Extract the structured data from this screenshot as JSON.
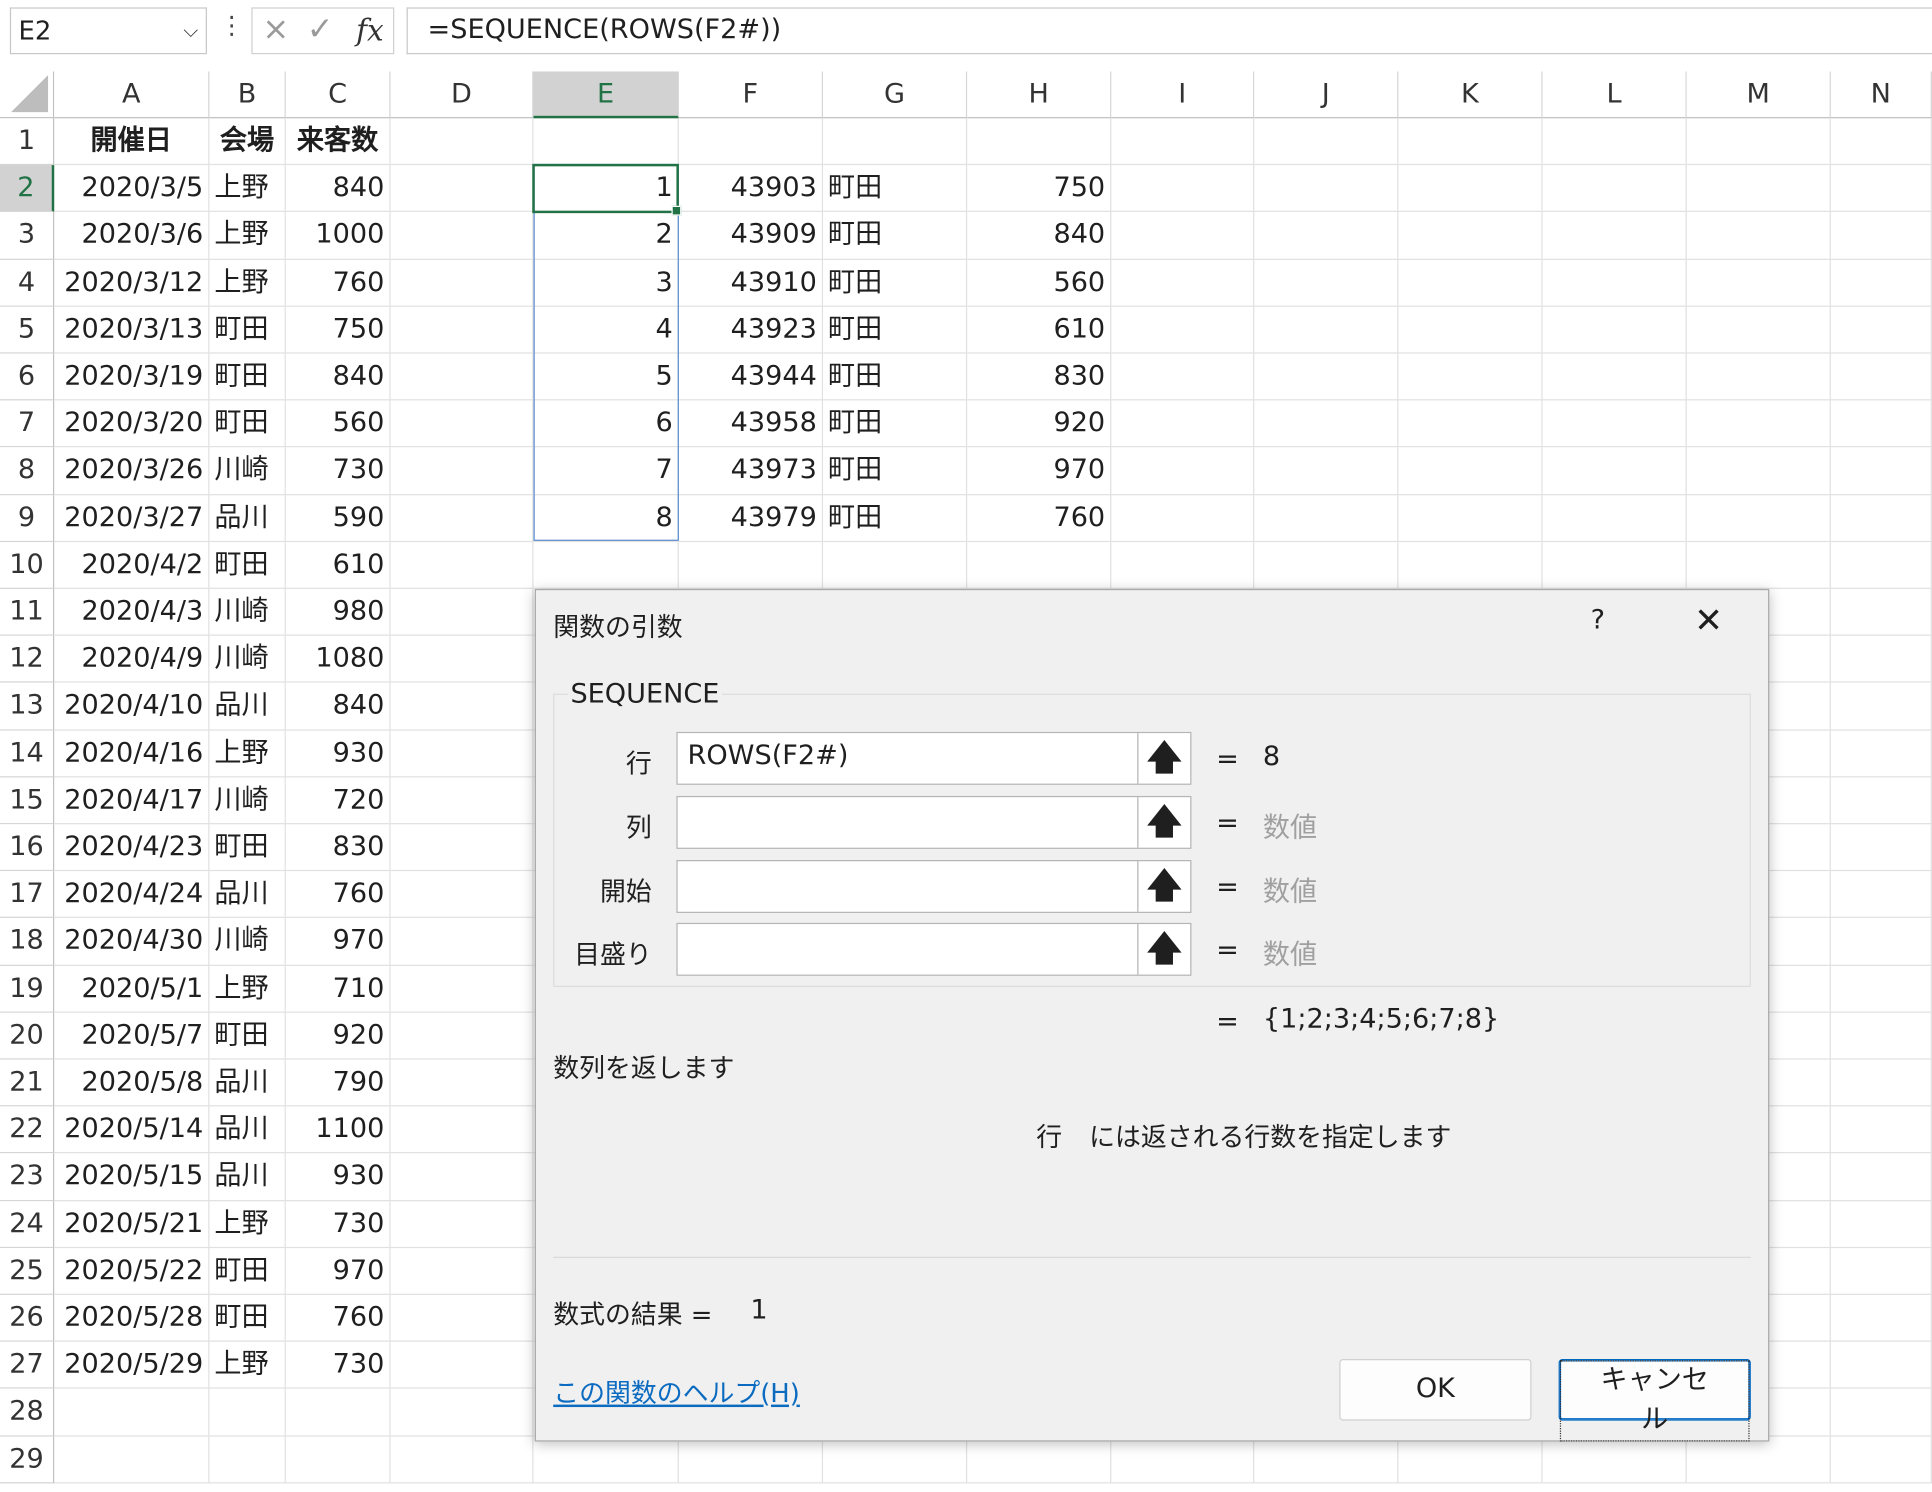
{
  "formula_bar": {
    "name_box": "E2",
    "formula": "=SEQUENCE(ROWS(F2#))",
    "cancel_icon": "×",
    "enter_icon": "✓",
    "fx_icon": "fx"
  },
  "columns": [
    "A",
    "B",
    "C",
    "D",
    "E",
    "F",
    "G",
    "H",
    "I",
    "J",
    "K",
    "L",
    "M",
    "N"
  ],
  "rows": [
    "1",
    "2",
    "3",
    "4",
    "5",
    "6",
    "7",
    "8",
    "9",
    "10",
    "11",
    "12",
    "13",
    "14",
    "15",
    "16",
    "17",
    "18",
    "19",
    "20",
    "21",
    "22",
    "23",
    "24",
    "25",
    "26",
    "27",
    "28",
    "29"
  ],
  "headers": {
    "date": "開催日",
    "venue": "会場",
    "visitors": "来客数"
  },
  "table": [
    [
      "2020/3/5",
      "上野",
      "840"
    ],
    [
      "2020/3/6",
      "上野",
      "1000"
    ],
    [
      "2020/3/12",
      "上野",
      "760"
    ],
    [
      "2020/3/13",
      "町田",
      "750"
    ],
    [
      "2020/3/19",
      "町田",
      "840"
    ],
    [
      "2020/3/20",
      "町田",
      "560"
    ],
    [
      "2020/3/26",
      "川崎",
      "730"
    ],
    [
      "2020/3/27",
      "品川",
      "590"
    ],
    [
      "2020/4/2",
      "町田",
      "610"
    ],
    [
      "2020/4/3",
      "川崎",
      "980"
    ],
    [
      "2020/4/9",
      "川崎",
      "1080"
    ],
    [
      "2020/4/10",
      "品川",
      "840"
    ],
    [
      "2020/4/16",
      "上野",
      "930"
    ],
    [
      "2020/4/17",
      "川崎",
      "720"
    ],
    [
      "2020/4/23",
      "町田",
      "830"
    ],
    [
      "2020/4/24",
      "品川",
      "760"
    ],
    [
      "2020/4/30",
      "川崎",
      "970"
    ],
    [
      "2020/5/1",
      "上野",
      "710"
    ],
    [
      "2020/5/7",
      "町田",
      "920"
    ],
    [
      "2020/5/8",
      "品川",
      "790"
    ],
    [
      "2020/5/14",
      "品川",
      "1100"
    ],
    [
      "2020/5/15",
      "品川",
      "930"
    ],
    [
      "2020/5/21",
      "上野",
      "730"
    ],
    [
      "2020/5/22",
      "町田",
      "970"
    ],
    [
      "2020/5/28",
      "町田",
      "760"
    ],
    [
      "2020/5/29",
      "上野",
      "730"
    ]
  ],
  "spill_e": [
    "1",
    "2",
    "3",
    "4",
    "5",
    "6",
    "7",
    "8"
  ],
  "spill_fgh": [
    [
      "43903",
      "町田",
      "750"
    ],
    [
      "43909",
      "町田",
      "840"
    ],
    [
      "43910",
      "町田",
      "560"
    ],
    [
      "43923",
      "町田",
      "610"
    ],
    [
      "43944",
      "町田",
      "830"
    ],
    [
      "43958",
      "町田",
      "920"
    ],
    [
      "43973",
      "町田",
      "970"
    ],
    [
      "43979",
      "町田",
      "760"
    ]
  ],
  "dialog": {
    "title": "関数の引数",
    "help_icon": "?",
    "close_icon": "✕",
    "function_name": "SEQUENCE",
    "args": [
      {
        "label": "行",
        "value": "ROWS(F2#)",
        "result": "8",
        "result_placeholder": false
      },
      {
        "label": "列",
        "value": "",
        "result": "数値",
        "result_placeholder": true
      },
      {
        "label": "開始",
        "value": "",
        "result": "数値",
        "result_placeholder": true
      },
      {
        "label": "目盛り",
        "value": "",
        "result": "数値",
        "result_placeholder": true
      }
    ],
    "ref_icon": "🡅",
    "equals": "=",
    "overall_result": "{1;2;3;4;5;6;7;8}",
    "description": "数列を返します",
    "arg_desc_name": "行",
    "arg_desc": "には返される行数を指定します",
    "formula_result_label": "数式の結果 =",
    "formula_result_value": "1",
    "help_link": "この関数のヘルプ(H)",
    "ok": "OK",
    "cancel": "キャンセル"
  }
}
